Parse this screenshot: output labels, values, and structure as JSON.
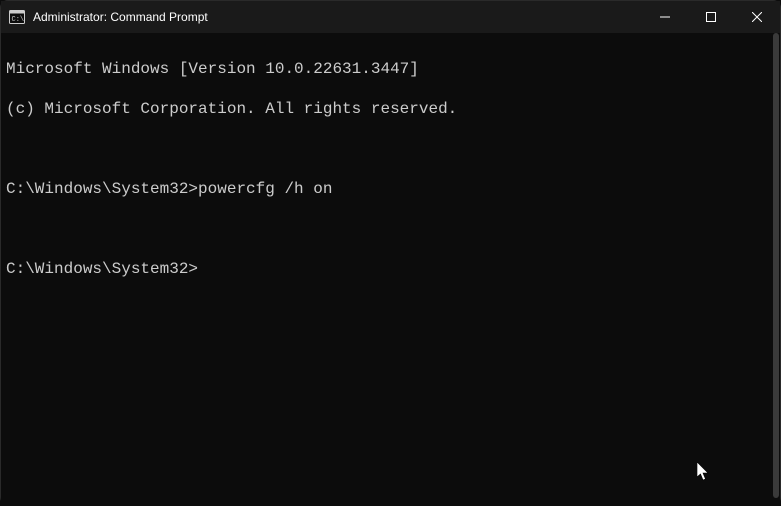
{
  "window": {
    "title": "Administrator: Command Prompt"
  },
  "terminal": {
    "line1": "Microsoft Windows [Version 10.0.22631.3447]",
    "line2": "(c) Microsoft Corporation. All rights reserved.",
    "blank1": "",
    "prompt1_path": "C:\\Windows\\System32>",
    "prompt1_cmd": "powercfg /h on",
    "blank2": "",
    "prompt2_path": "C:\\Windows\\System32>"
  }
}
